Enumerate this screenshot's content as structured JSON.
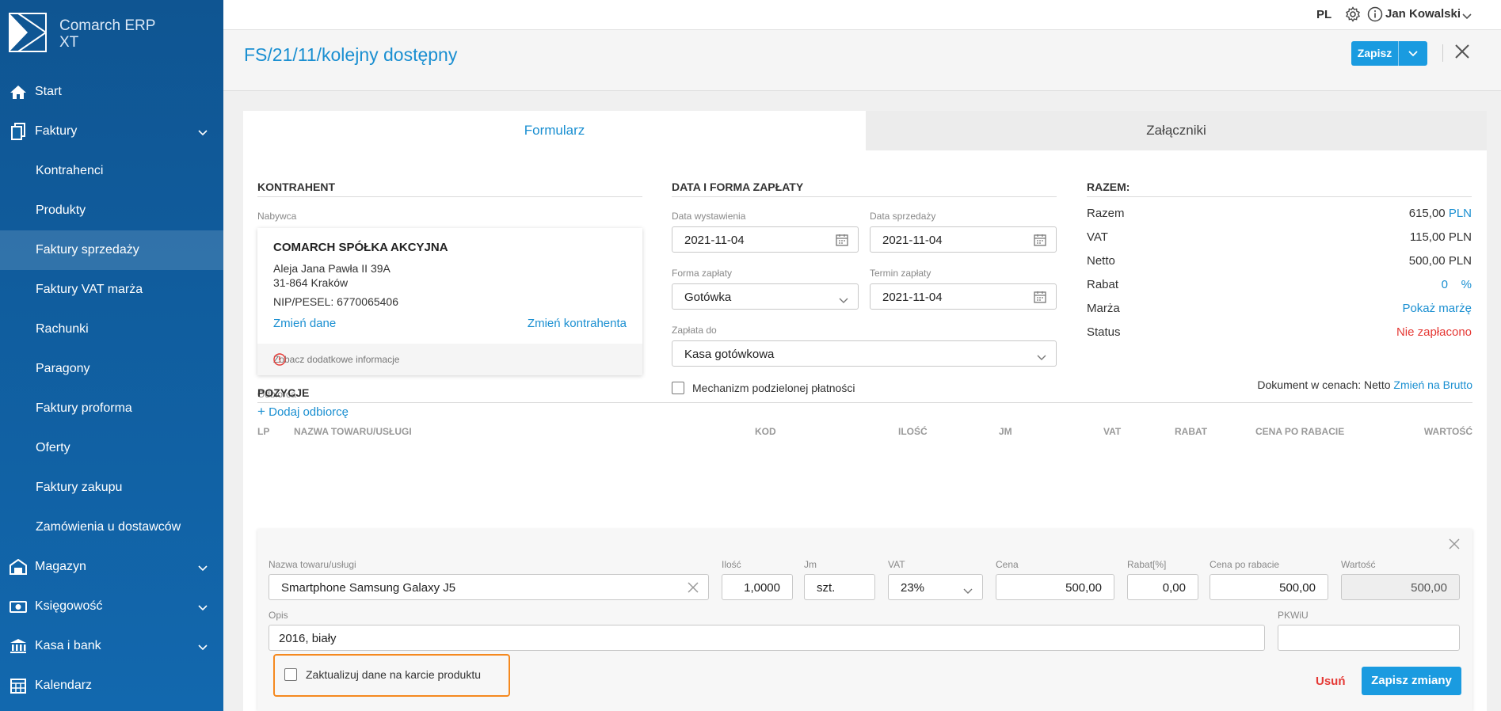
{
  "app": {
    "name_line1": "Comarch ERP",
    "name_line2": "XT"
  },
  "sidebar": {
    "items": [
      {
        "label": "Start",
        "icon": "home-icon"
      },
      {
        "label": "Faktury",
        "icon": "documents-icon",
        "expandable": true
      },
      {
        "label": "Kontrahenci"
      },
      {
        "label": "Produkty"
      },
      {
        "label": "Faktury sprzedaży",
        "active": true
      },
      {
        "label": "Faktury VAT marża"
      },
      {
        "label": "Rachunki"
      },
      {
        "label": "Paragony"
      },
      {
        "label": "Faktury proforma"
      },
      {
        "label": "Oferty"
      },
      {
        "label": "Faktury zakupu"
      },
      {
        "label": "Zamówienia u dostawców"
      },
      {
        "label": "Magazyn",
        "icon": "warehouse-icon",
        "expandable": true
      },
      {
        "label": "Księgowość",
        "icon": "accounting-icon",
        "expandable": true
      },
      {
        "label": "Kasa i bank",
        "icon": "bank-icon",
        "expandable": true
      },
      {
        "label": "Kalendarz",
        "icon": "calendar-icon"
      }
    ]
  },
  "topbar": {
    "lang": "PL",
    "user": "Jan Kowalski"
  },
  "header": {
    "title": "FS/21/11/kolejny dostępny",
    "save_label": "Zapisz"
  },
  "tabs": [
    "Formularz",
    "Załączniki"
  ],
  "contractor": {
    "section": "KONTRAHENT",
    "buyer_label": "Nabywca",
    "name": "COMARCH SPÓŁKA AKCYJNA",
    "address1": "Aleja Jana Pawła II 39A",
    "address2": "31-864 Kraków",
    "nip": "NIP/PESEL: 6770065406",
    "change_data": "Zmień dane",
    "change_contractor": "Zmień kontrahenta",
    "more_info": "Zobacz dodatkowe informacje",
    "recipient_label": "Odbiorca",
    "add_recipient": "Dodaj odbiorcę"
  },
  "payment": {
    "section": "DATA I FORMA ZAPŁATY",
    "issue_date_label": "Data wystawienia",
    "issue_date": "2021-11-04",
    "sale_date_label": "Data sprzedaży",
    "sale_date": "2021-11-04",
    "form_label": "Forma zapłaty",
    "form": "Gotówka",
    "due_label": "Termin zapłaty",
    "due": "2021-11-04",
    "paid_to_label": "Zapłata do",
    "paid_to": "Kasa gotówkowa",
    "split_payment": "Mechanizm podzielonej płatności"
  },
  "totals": {
    "section": "RAZEM:",
    "rows": [
      {
        "label": "Razem",
        "value": "615,00",
        "unit": "PLN"
      },
      {
        "label": "VAT",
        "value": "115,00",
        "unit": "PLN"
      },
      {
        "label": "Netto",
        "value": "500,00",
        "unit": "PLN"
      },
      {
        "label": "Rabat",
        "value": "0",
        "unit": "%"
      },
      {
        "label": "Marża",
        "value": "Pokaż marżę"
      },
      {
        "label": "Status",
        "value": "Nie zapłacono"
      }
    ]
  },
  "positions": {
    "section": "POZYCJE",
    "price_mode_text": "Dokument w cenach: Netto",
    "switch_link": "Zmień na Brutto",
    "columns": [
      "LP",
      "NAZWA TOWARU/USŁUGI",
      "KOD",
      "ILOŚĆ",
      "JM",
      "VAT",
      "RABAT",
      "CENA PO RABACIE",
      "WARTOŚĆ"
    ]
  },
  "edit": {
    "name_label": "Nazwa towaru/usługi",
    "name": "Smartphone Samsung Galaxy J5",
    "qty_label": "Ilość",
    "qty": "1,0000",
    "unit_label": "Jm",
    "unit": "szt.",
    "vat_label": "VAT",
    "vat": "23%",
    "price_label": "Cena",
    "price": "500,00",
    "discount_label": "Rabat[%]",
    "discount": "0,00",
    "net_price_label": "Cena po rabacie",
    "net_price": "500,00",
    "value_label": "Wartość",
    "value": "500,00",
    "desc_label": "Opis",
    "desc": "2016, biały",
    "pkwiu_label": "PKWiU",
    "pkwiu": "",
    "update_card": "Zaktualizuj dane na karcie produktu",
    "delete_label": "Usuń",
    "save_changes_label": "Zapisz zmiany"
  },
  "colors": {
    "accent": "#1a8fd1",
    "sidebar": "#1268ae",
    "danger": "#e53935",
    "highlight": "#f5891f"
  }
}
